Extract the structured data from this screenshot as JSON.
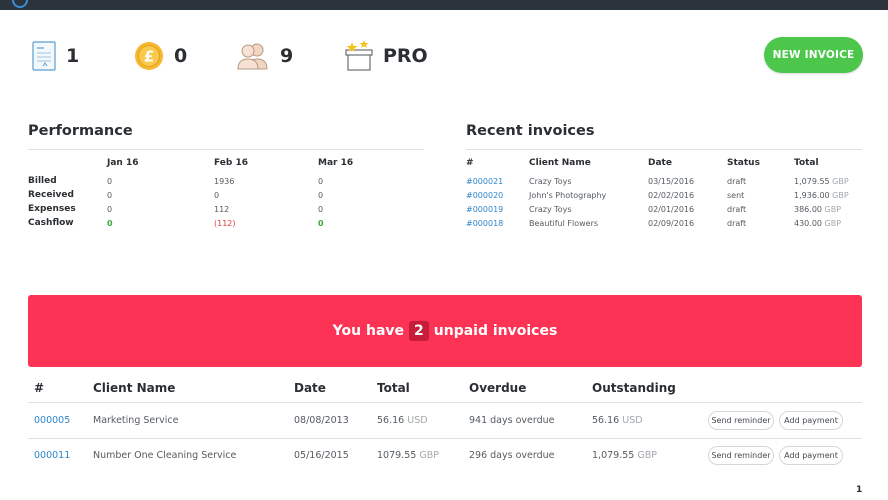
{
  "colors": {
    "accent_green": "#4cc74c",
    "banner_red": "#fd3355",
    "link_blue": "#2f86c9",
    "positive": "#3aa83a",
    "negative": "#e03c3c"
  },
  "stats": [
    {
      "icon": "invoice-document-icon",
      "value": "1"
    },
    {
      "icon": "pound-coin-icon",
      "value": "0"
    },
    {
      "icon": "clients-icon",
      "value": "9"
    },
    {
      "icon": "pro-gift-box-icon",
      "value": "PRO"
    }
  ],
  "new_invoice_label": "NEW INVOICE",
  "performance": {
    "title": "Performance",
    "columns": [
      "Jan 16",
      "Feb 16",
      "Mar 16"
    ],
    "rows": [
      {
        "label": "Billed",
        "values": [
          "0",
          "1936",
          "0"
        ]
      },
      {
        "label": "Received",
        "values": [
          "0",
          "0",
          "0"
        ]
      },
      {
        "label": "Expenses",
        "values": [
          "0",
          "112",
          "0"
        ]
      },
      {
        "label": "Cashflow",
        "values": [
          "0",
          "(112)",
          "0"
        ]
      }
    ]
  },
  "recent": {
    "title": "Recent invoices",
    "headers": [
      "#",
      "Client Name",
      "Date",
      "Status",
      "Total"
    ],
    "rows": [
      {
        "id": "#000021",
        "client": "Crazy Toys",
        "date": "03/15/2016",
        "status": "draft",
        "total": "1,079.55",
        "cur": "GBP"
      },
      {
        "id": "#000020",
        "client": "John's Photography",
        "date": "02/02/2016",
        "status": "sent",
        "total": "1,936.00",
        "cur": "GBP"
      },
      {
        "id": "#000019",
        "client": "Crazy Toys",
        "date": "02/01/2016",
        "status": "draft",
        "total": "386.00",
        "cur": "GBP"
      },
      {
        "id": "#000018",
        "client": "Beautiful Flowers",
        "date": "02/09/2016",
        "status": "draft",
        "total": "430.00",
        "cur": "GBP"
      }
    ]
  },
  "banner": {
    "prefix": "You have",
    "count": "2",
    "suffix": "unpaid invoices"
  },
  "unpaid": {
    "headers": [
      "#",
      "Client Name",
      "Date",
      "Total",
      "Overdue",
      "Outstanding"
    ],
    "rows": [
      {
        "id": "000005",
        "client": "Marketing Service",
        "date": "08/08/2013",
        "total": "56.16",
        "total_cur": "USD",
        "overdue": "941 days overdue",
        "outstanding": "56.16",
        "out_cur": "USD"
      },
      {
        "id": "000011",
        "client": "Number One Cleaning Service",
        "date": "05/16/2015",
        "total": "1079.55",
        "total_cur": "GBP",
        "overdue": "296 days overdue",
        "outstanding": "1,079.55",
        "out_cur": "GBP"
      }
    ],
    "send_reminder": "Send reminder",
    "add_payment": "Add payment"
  },
  "pagination": {
    "page": "1"
  }
}
